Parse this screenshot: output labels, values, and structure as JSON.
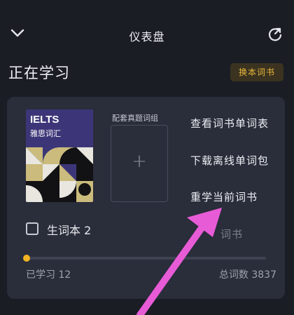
{
  "header": {
    "title": "仪表盘",
    "back_icon": "chevron-down-icon",
    "refresh_icon": "refresh-icon"
  },
  "section": {
    "title": "正在学习",
    "change_book_label": "换本词书"
  },
  "book": {
    "cover_title": "IELTS",
    "cover_subtitle": "雅思词汇",
    "supplement_label": "配套真题词组",
    "add_icon": "plus-icon"
  },
  "menu": {
    "items": [
      {
        "label": "查看词书单词表"
      },
      {
        "label": "下载离线单词包"
      },
      {
        "label": "重学当前词书"
      },
      {
        "label": "词书"
      }
    ]
  },
  "vocab": {
    "label": "生词本 2",
    "checked": false
  },
  "progress": {
    "learned_label": "已学习 12",
    "total_label": "总词数 3837",
    "learned": 12,
    "total": 3837
  },
  "colors": {
    "accent": "#f2b424",
    "annotation_arrow": "#e85bd7",
    "background": "#1b1d25",
    "card": "#2a2d3a"
  }
}
